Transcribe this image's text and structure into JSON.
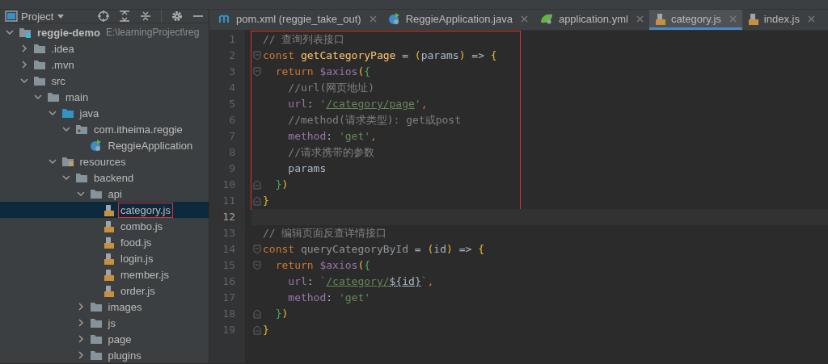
{
  "project_panel": {
    "title": "Project"
  },
  "project_tree": [
    {
      "name": "reggie-demo",
      "kind": "module",
      "path_hint": "E:\\learningProject\\reg",
      "expanded": true,
      "selected": false,
      "marked": false,
      "children": [
        {
          "name": ".idea",
          "kind": "folder",
          "expanded": false,
          "selected": false,
          "marked": false
        },
        {
          "name": ".mvn",
          "kind": "folder",
          "expanded": false,
          "selected": false,
          "marked": false
        },
        {
          "name": "src",
          "kind": "folder",
          "expanded": true,
          "selected": false,
          "marked": false,
          "children": [
            {
              "name": "main",
              "kind": "folder",
              "expanded": true,
              "selected": false,
              "marked": false,
              "children": [
                {
                  "name": "java",
                  "kind": "source",
                  "expanded": true,
                  "selected": false,
                  "marked": false,
                  "children": [
                    {
                      "name": "com.itheima.reggie",
                      "kind": "package",
                      "expanded": true,
                      "selected": false,
                      "marked": false,
                      "children": [
                        {
                          "name": "ReggieApplication",
                          "kind": "app-class",
                          "selected": false,
                          "marked": false
                        }
                      ]
                    }
                  ]
                },
                {
                  "name": "resources",
                  "kind": "resources",
                  "expanded": true,
                  "selected": false,
                  "marked": false,
                  "children": [
                    {
                      "name": "backend",
                      "kind": "folder",
                      "expanded": true,
                      "selected": false,
                      "marked": false,
                      "children": [
                        {
                          "name": "api",
                          "kind": "folder",
                          "expanded": true,
                          "selected": false,
                          "marked": false,
                          "children": [
                            {
                              "name": "category.js",
                              "kind": "js",
                              "selected": true,
                              "marked": true
                            },
                            {
                              "name": "combo.js",
                              "kind": "js",
                              "selected": false,
                              "marked": false
                            },
                            {
                              "name": "food.js",
                              "kind": "js",
                              "selected": false,
                              "marked": false
                            },
                            {
                              "name": "login.js",
                              "kind": "js",
                              "selected": false,
                              "marked": false
                            },
                            {
                              "name": "member.js",
                              "kind": "js",
                              "selected": false,
                              "marked": false
                            },
                            {
                              "name": "order.js",
                              "kind": "js",
                              "selected": false,
                              "marked": false
                            }
                          ]
                        },
                        {
                          "name": "images",
                          "kind": "folder",
                          "expanded": false,
                          "selected": false,
                          "marked": false
                        },
                        {
                          "name": "js",
                          "kind": "folder",
                          "expanded": false,
                          "selected": false,
                          "marked": false
                        },
                        {
                          "name": "page",
                          "kind": "folder",
                          "expanded": false,
                          "selected": false,
                          "marked": false
                        },
                        {
                          "name": "plugins",
                          "kind": "folder",
                          "expanded": false,
                          "selected": false,
                          "marked": false
                        }
                      ]
                    }
                  ]
                }
              ]
            }
          ]
        }
      ]
    }
  ],
  "tabs": [
    {
      "label": "pom.xml (reggie_take_out)",
      "kind": "maven",
      "selected": false
    },
    {
      "label": "ReggieApplication.java",
      "kind": "app-class",
      "selected": false
    },
    {
      "label": "application.yml",
      "kind": "yaml",
      "selected": false
    },
    {
      "label": "category.js",
      "kind": "js",
      "selected": true
    },
    {
      "label": "index.js",
      "kind": "js",
      "selected": false
    }
  ],
  "code_lines": [
    {
      "number": "1",
      "kind": "plain",
      "boxed": true,
      "current": false,
      "tokens": [
        {
          "text": "// 查询列表接口",
          "kind": "comment"
        }
      ]
    },
    {
      "number": "2",
      "kind": "fold-open",
      "boxed": true,
      "current": false,
      "tokens": [
        {
          "text": "const ",
          "kind": "kw"
        },
        {
          "text": "getCategoryPage",
          "kind": "func"
        },
        {
          "text": " = ",
          "kind": "plain"
        },
        {
          "text": "(",
          "kind": "p1"
        },
        {
          "text": "params",
          "kind": "plain"
        },
        {
          "text": ")",
          "kind": "p1"
        },
        {
          "text": " => ",
          "kind": "plain"
        },
        {
          "text": "{",
          "kind": "p1"
        }
      ]
    },
    {
      "number": "3",
      "kind": "fold-open",
      "boxed": true,
      "current": false,
      "tokens": [
        {
          "text": "  return ",
          "kind": "kw"
        },
        {
          "text": "$axios",
          "kind": "var"
        },
        {
          "text": "(",
          "kind": "p1"
        },
        {
          "text": "{",
          "kind": "p2"
        }
      ]
    },
    {
      "number": "4",
      "kind": "plain",
      "boxed": true,
      "current": false,
      "tokens": [
        {
          "text": "    //url(网页地址)",
          "kind": "comment"
        }
      ]
    },
    {
      "number": "5",
      "kind": "plain",
      "boxed": true,
      "current": false,
      "tokens": [
        {
          "text": "    url",
          "kind": "prop"
        },
        {
          "text": ": ",
          "kind": "plain"
        },
        {
          "text": "'",
          "kind": "str"
        },
        {
          "text": "/category/page",
          "kind": "url"
        },
        {
          "text": "'",
          "kind": "str"
        },
        {
          "text": ",",
          "kind": "kw"
        }
      ]
    },
    {
      "number": "6",
      "kind": "plain",
      "boxed": true,
      "current": false,
      "tokens": [
        {
          "text": "    //method(请求类型): get或post",
          "kind": "comment"
        }
      ]
    },
    {
      "number": "7",
      "kind": "plain",
      "boxed": true,
      "current": false,
      "tokens": [
        {
          "text": "    method",
          "kind": "prop"
        },
        {
          "text": ": ",
          "kind": "plain"
        },
        {
          "text": "'get'",
          "kind": "str"
        },
        {
          "text": ",",
          "kind": "kw"
        }
      ]
    },
    {
      "number": "8",
      "kind": "plain",
      "boxed": true,
      "current": false,
      "tokens": [
        {
          "text": "    //请求携带的参数",
          "kind": "comment"
        }
      ]
    },
    {
      "number": "9",
      "kind": "plain",
      "boxed": true,
      "current": false,
      "tokens": [
        {
          "text": "    params",
          "kind": "plain"
        }
      ]
    },
    {
      "number": "10",
      "kind": "fold-close",
      "boxed": true,
      "current": false,
      "tokens": [
        {
          "text": "  }",
          "kind": "p2"
        },
        {
          "text": ")",
          "kind": "p1"
        }
      ]
    },
    {
      "number": "11",
      "kind": "fold-close",
      "boxed": true,
      "current": false,
      "tokens": [
        {
          "text": "}",
          "kind": "p1"
        }
      ]
    },
    {
      "number": "12",
      "kind": "plain",
      "boxed": false,
      "current": true
    },
    {
      "number": "13",
      "kind": "plain",
      "boxed": false,
      "current": false,
      "tokens": [
        {
          "text": "// 编辑页面反查详情接口",
          "kind": "comment"
        }
      ]
    },
    {
      "number": "14",
      "kind": "fold-open",
      "boxed": false,
      "current": false,
      "tokens": [
        {
          "text": "const ",
          "kind": "kw"
        },
        {
          "text": "queryCategoryById",
          "kind": "unused"
        },
        {
          "text": " = ",
          "kind": "plain"
        },
        {
          "text": "(",
          "kind": "p1"
        },
        {
          "text": "id",
          "kind": "plain"
        },
        {
          "text": ")",
          "kind": "p1"
        },
        {
          "text": " => ",
          "kind": "plain"
        },
        {
          "text": "{",
          "kind": "p1"
        }
      ]
    },
    {
      "number": "15",
      "kind": "fold-open",
      "boxed": false,
      "current": false,
      "tokens": [
        {
          "text": "  return ",
          "kind": "kw"
        },
        {
          "text": "$axios",
          "kind": "var"
        },
        {
          "text": "(",
          "kind": "p1"
        },
        {
          "text": "{",
          "kind": "p2"
        }
      ]
    },
    {
      "number": "16",
      "kind": "plain",
      "boxed": false,
      "current": false,
      "tokens": [
        {
          "text": "    url",
          "kind": "prop"
        },
        {
          "text": ": ",
          "kind": "plain"
        },
        {
          "text": "`",
          "kind": "str"
        },
        {
          "text": "/category/",
          "kind": "url"
        },
        {
          "text": "${",
          "kind": "interp"
        },
        {
          "text": "id",
          "kind": "interp"
        },
        {
          "text": "}",
          "kind": "interp"
        },
        {
          "text": "`",
          "kind": "str"
        },
        {
          "text": ",",
          "kind": "kw"
        }
      ]
    },
    {
      "number": "17",
      "kind": "plain",
      "boxed": false,
      "current": false,
      "tokens": [
        {
          "text": "    method",
          "kind": "prop"
        },
        {
          "text": ": ",
          "kind": "plain"
        },
        {
          "text": "'get'",
          "kind": "str"
        }
      ]
    },
    {
      "number": "18",
      "kind": "fold-close",
      "boxed": false,
      "current": false,
      "tokens": [
        {
          "text": "  }",
          "kind": "p2"
        },
        {
          "text": ")",
          "kind": "p1"
        }
      ]
    },
    {
      "number": "19",
      "kind": "fold-close",
      "boxed": false,
      "current": false,
      "tokens": [
        {
          "text": "}",
          "kind": "p1"
        }
      ]
    }
  ]
}
